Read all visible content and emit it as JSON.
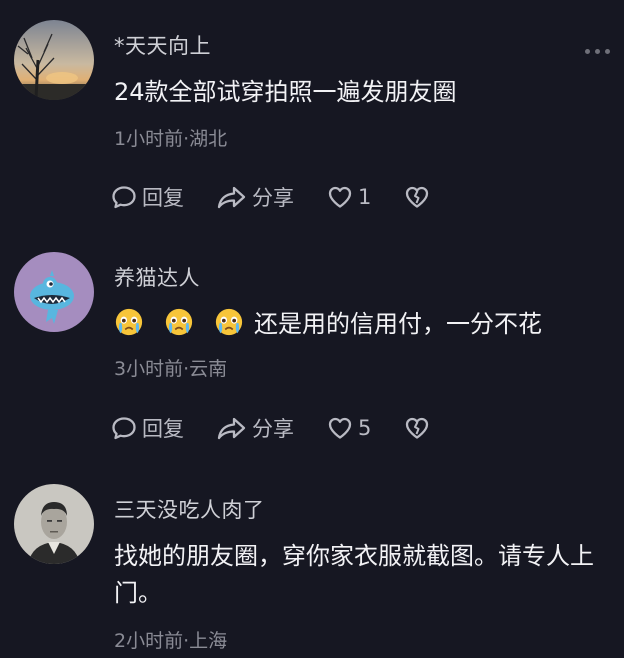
{
  "comments": [
    {
      "username": "*天天向上",
      "text": "24款全部试穿拍照一遍发朋友圈",
      "meta": "1小时前·湖北",
      "reply_label": "回复",
      "share_label": "分享",
      "likes": "1",
      "avatar": "sunset-tree-photo"
    },
    {
      "username": "养猫达人",
      "text": "还是用的信用付，一分不花",
      "emoji_count": 3,
      "emoji": "crying-face-emoji",
      "meta": "3小时前·云南",
      "reply_label": "回复",
      "share_label": "分享",
      "likes": "5",
      "avatar": "blue-cartoon-monster"
    },
    {
      "username": "三天没吃人肉了",
      "text": "找她的朋友圈，穿你家衣服就截图。请专人上门。",
      "meta": "2小时前·上海",
      "avatar": "vintage-portrait-photo"
    }
  ],
  "colors": {
    "background": "#161722",
    "username": "#cfd0d6",
    "content": "#f2f2f5",
    "meta": "#8a8b95",
    "action": "#b9bac3"
  }
}
